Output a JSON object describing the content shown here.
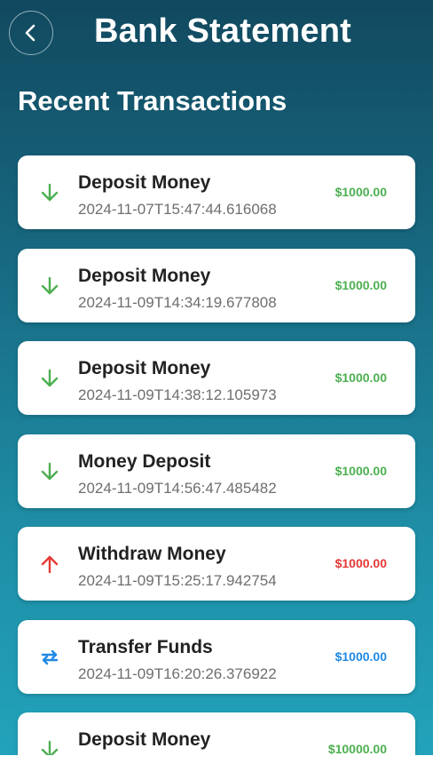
{
  "header": {
    "title": "Bank Statement",
    "back_icon": "chevron-left-icon"
  },
  "section": {
    "title": "Recent Transactions"
  },
  "colors": {
    "deposit": "#4caf50",
    "withdraw": "#e53935",
    "transfer": "#1e88e5"
  },
  "transactions": [
    {
      "type": "deposit",
      "icon": "arrow-down-icon",
      "title": "Deposit Money",
      "timestamp": "2024-11-07T15:47:44.616068",
      "amount": "$1000.00"
    },
    {
      "type": "deposit",
      "icon": "arrow-down-icon",
      "title": "Deposit Money",
      "timestamp": "2024-11-09T14:34:19.677808",
      "amount": "$1000.00"
    },
    {
      "type": "deposit",
      "icon": "arrow-down-icon",
      "title": "Deposit Money",
      "timestamp": "2024-11-09T14:38:12.105973",
      "amount": "$1000.00"
    },
    {
      "type": "deposit",
      "icon": "arrow-down-icon",
      "title": "Money Deposit",
      "timestamp": "2024-11-09T14:56:47.485482",
      "amount": "$1000.00"
    },
    {
      "type": "withdraw",
      "icon": "arrow-up-icon",
      "title": "Withdraw Money",
      "timestamp": "2024-11-09T15:25:17.942754",
      "amount": "$1000.00"
    },
    {
      "type": "transfer",
      "icon": "swap-arrows-icon",
      "title": "Transfer Funds",
      "timestamp": "2024-11-09T16:20:26.376922",
      "amount": "$1000.00"
    },
    {
      "type": "deposit",
      "icon": "arrow-down-icon",
      "title": "Deposit Money",
      "timestamp": "",
      "amount": "$10000.00"
    }
  ]
}
